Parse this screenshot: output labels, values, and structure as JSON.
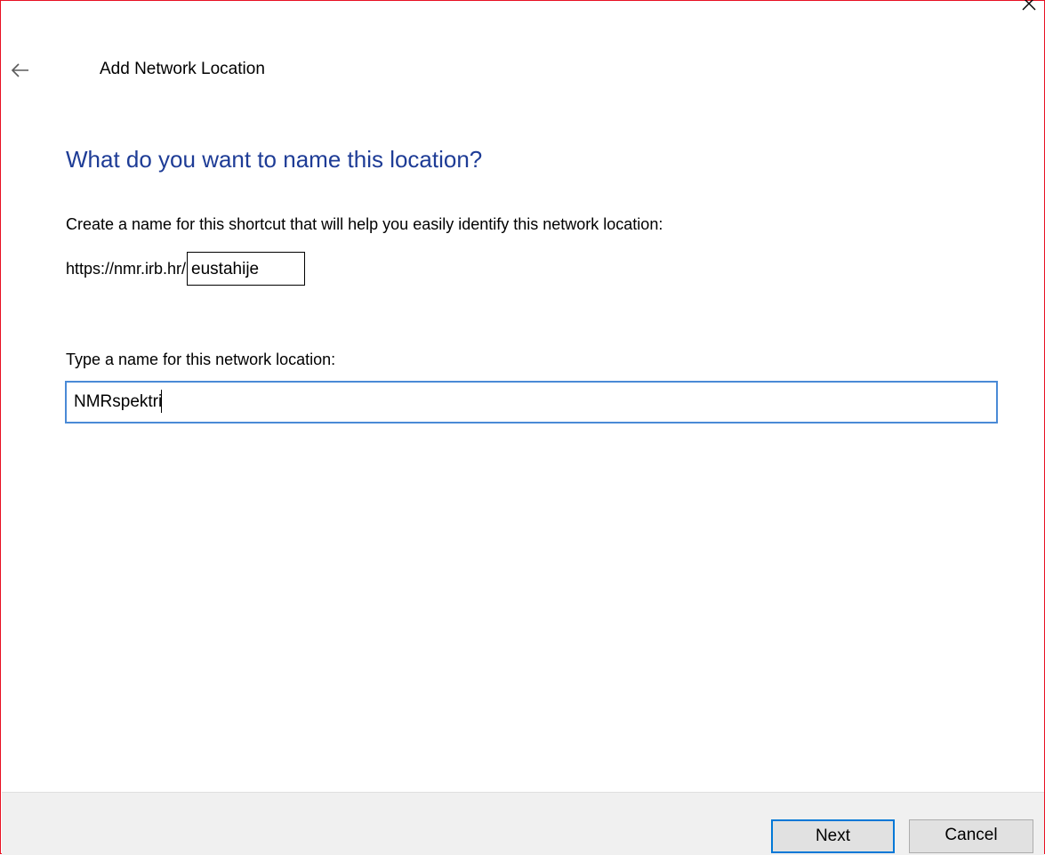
{
  "window": {
    "title": "Add Network Location"
  },
  "content": {
    "heading": "What do you want to name this location?",
    "description": "Create a name for this shortcut that will help you easily identify this network location:",
    "url_prefix": "https://nmr.irb.hr/",
    "url_suffix": "eustahije",
    "name_label": "Type a name for this network location:",
    "name_value": "NMRspektri"
  },
  "footer": {
    "next_label": "Next",
    "cancel_label": "Cancel"
  },
  "icons": {
    "back": "back-arrow-icon",
    "close": "close-icon"
  },
  "colors": {
    "heading": "#1e3c96",
    "input_focus_border": "#4a8ad6",
    "default_button_border": "#0078d7",
    "window_border": "#e81123",
    "footer_background": "#f0f0f0"
  }
}
